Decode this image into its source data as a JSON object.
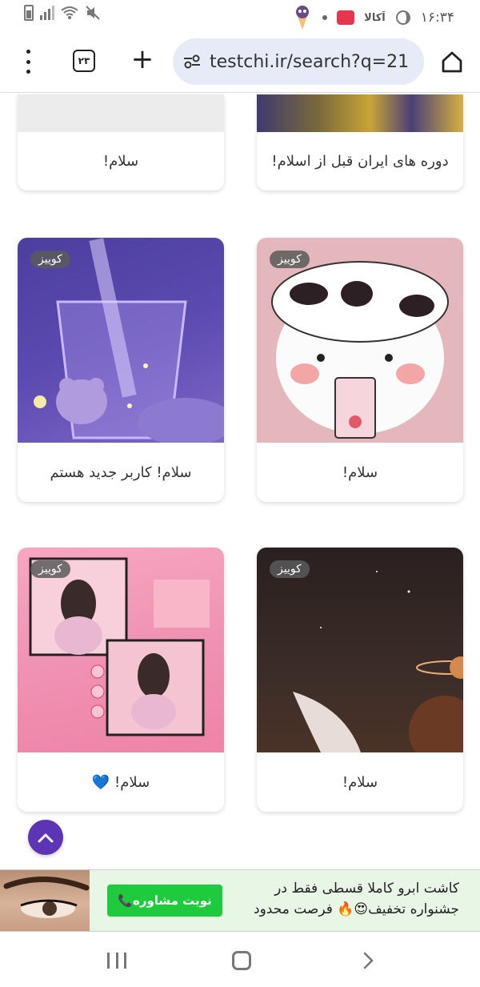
{
  "status_bar": {
    "time": "۱۶:۳۴",
    "app_label": "اَکالا"
  },
  "browser": {
    "tabs_count": "۲۳",
    "url": "testchi.ir/search?q=21"
  },
  "cards": [
    {
      "title": "دوره های ایران قبل از اسلام!"
    },
    {
      "title": "سلام!"
    },
    {
      "title": "سلام!",
      "badge": "کوییز"
    },
    {
      "title": "سلام! کاربر جدید هستم",
      "badge": "کوییز"
    },
    {
      "title": "سلام!",
      "badge": "کوییز"
    },
    {
      "title": "سلام! 💙",
      "badge": "کوییز"
    }
  ],
  "ad": {
    "line1": "کاشت ابرو کاملا قسطی فقط در",
    "line2": "جشنواره تخفیف😍🔥 فرصت محدود",
    "button": "نوبت مشاوره📞"
  },
  "colors": {
    "accent": "#5b35b5",
    "ad_button": "#1ecb3c",
    "url_bar": "#e6ebf7"
  }
}
